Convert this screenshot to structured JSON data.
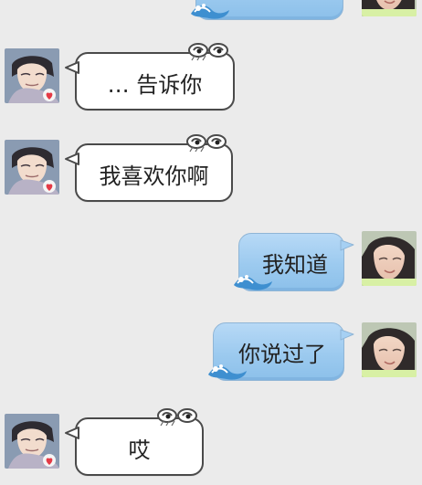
{
  "messages": [
    {
      "side": "right",
      "text": ""
    },
    {
      "side": "left",
      "text": "… 告诉你"
    },
    {
      "side": "left",
      "text": "我喜欢你啊"
    },
    {
      "side": "right",
      "text": "我知道"
    },
    {
      "side": "right",
      "text": "你说过了"
    },
    {
      "side": "left",
      "text": "哎"
    }
  ],
  "colors": {
    "background": "#ebebeb",
    "incoming_bubble": "#ffffff",
    "outgoing_bubble": "#9ccaef"
  },
  "icons": {
    "incoming_decor": "cartoon-eyes-icon",
    "outgoing_decor": "wave-icon"
  }
}
